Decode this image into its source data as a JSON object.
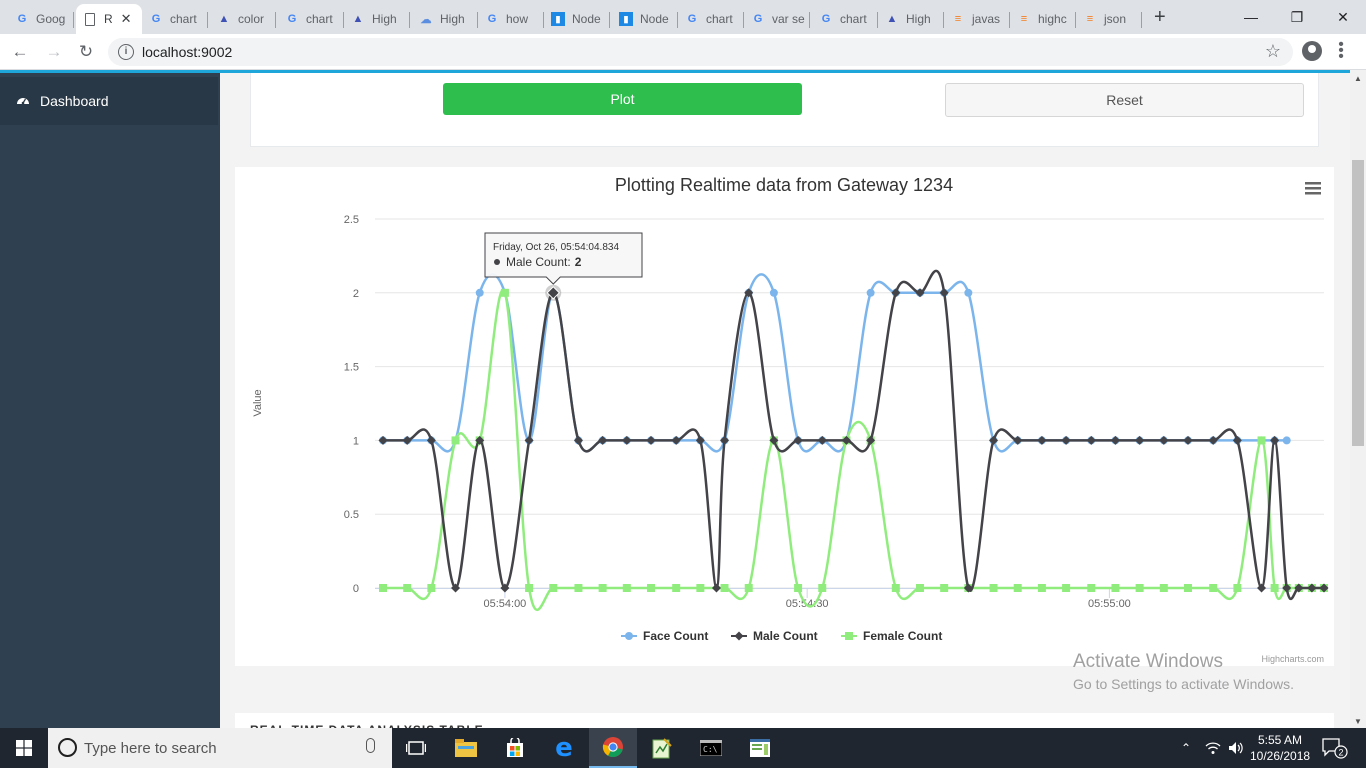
{
  "browser": {
    "tabs": [
      {
        "label": "Goog",
        "icon": "google-icon"
      },
      {
        "label": "R",
        "icon": "page-icon",
        "active": true
      },
      {
        "label": "chart",
        "icon": "google-icon"
      },
      {
        "label": "color",
        "icon": "azure-icon"
      },
      {
        "label": "chart",
        "icon": "google-icon"
      },
      {
        "label": "High",
        "icon": "azure-icon"
      },
      {
        "label": "High",
        "icon": "cloud-icon"
      },
      {
        "label": "how",
        "icon": "google-icon"
      },
      {
        "label": "Node",
        "icon": "bar-chart-icon"
      },
      {
        "label": "Node",
        "icon": "bar-chart-icon"
      },
      {
        "label": "chart",
        "icon": "google-icon"
      },
      {
        "label": "var se",
        "icon": "g-icon"
      },
      {
        "label": "chart",
        "icon": "google-icon"
      },
      {
        "label": "High",
        "icon": "azure-icon"
      },
      {
        "label": "javas",
        "icon": "stack-overflow-icon"
      },
      {
        "label": "highc",
        "icon": "stack-overflow-icon"
      },
      {
        "label": "json",
        "icon": "stack-overflow-icon"
      }
    ],
    "url": "localhost:9002"
  },
  "sidebar": {
    "items": [
      {
        "label": "Dashboard",
        "icon": "dashboard-icon"
      }
    ]
  },
  "controls": {
    "plot_label": "Plot",
    "reset_label": "Reset"
  },
  "chart_data": {
    "type": "line",
    "title": "Plotting Realtime data from Gateway 1234",
    "xlabel": "",
    "ylabel": "Value",
    "ylim": [
      0,
      2.5
    ],
    "yticks": [
      "0",
      "0.5",
      "1",
      "1.5",
      "2",
      "2.5"
    ],
    "xticks": [
      {
        "label": "05:54:00",
        "t": 10
      },
      {
        "label": "05:54:30",
        "t": 40
      },
      {
        "label": "05:55:00",
        "t": 70
      }
    ],
    "time_offset_label": "seconds",
    "grid": true,
    "legend": "bottom-center",
    "series": [
      {
        "name": "Face Count",
        "color": "#7cb5ec",
        "marker": "circle",
        "points": [
          [
            -2.1,
            1
          ],
          [
            0.3,
            1
          ],
          [
            2.7,
            1
          ],
          [
            5.1,
            1
          ],
          [
            7.5,
            2
          ],
          [
            10,
            2
          ],
          [
            12.4,
            1
          ],
          [
            14.8,
            2
          ],
          [
            17.3,
            1
          ],
          [
            19.7,
            1
          ],
          [
            22.1,
            1
          ],
          [
            24.5,
            1
          ],
          [
            27,
            1
          ],
          [
            29.4,
            1
          ],
          [
            31.8,
            1
          ],
          [
            34.2,
            2
          ],
          [
            36.7,
            2
          ],
          [
            39.1,
            1
          ],
          [
            41.5,
            1
          ],
          [
            43.9,
            1
          ],
          [
            46.3,
            2
          ],
          [
            48.8,
            2
          ],
          [
            51.2,
            2
          ],
          [
            53.6,
            2
          ],
          [
            56,
            2
          ],
          [
            58.5,
            1
          ],
          [
            60.9,
            1
          ],
          [
            63.3,
            1
          ],
          [
            65.7,
            1
          ],
          [
            68.2,
            1
          ],
          [
            70.6,
            1
          ],
          [
            73,
            1
          ],
          [
            75.4,
            1
          ],
          [
            77.8,
            1
          ],
          [
            80.3,
            1
          ],
          [
            82.7,
            1
          ],
          [
            85.1,
            1
          ],
          [
            86.4,
            1
          ],
          [
            87.6,
            1
          ]
        ]
      },
      {
        "name": "Male Count",
        "color": "#434348",
        "marker": "diamond",
        "points": [
          [
            -2.1,
            1
          ],
          [
            0.3,
            1
          ],
          [
            2.7,
            1
          ],
          [
            5.1,
            0
          ],
          [
            7.5,
            1
          ],
          [
            10,
            0
          ],
          [
            12.4,
            1
          ],
          [
            14.8,
            2
          ],
          [
            17.3,
            1
          ],
          [
            19.7,
            1
          ],
          [
            22.1,
            1
          ],
          [
            24.5,
            1
          ],
          [
            27,
            1
          ],
          [
            29.4,
            1
          ],
          [
            31,
            0
          ],
          [
            31.8,
            1
          ],
          [
            34.2,
            2
          ],
          [
            36.7,
            1
          ],
          [
            39.1,
            1
          ],
          [
            41.5,
            1
          ],
          [
            43.9,
            1
          ],
          [
            46.3,
            1
          ],
          [
            48.8,
            2
          ],
          [
            51.2,
            2
          ],
          [
            53.6,
            2
          ],
          [
            56,
            0
          ],
          [
            58.5,
            1
          ],
          [
            60.9,
            1
          ],
          [
            63.3,
            1
          ],
          [
            65.7,
            1
          ],
          [
            68.2,
            1
          ],
          [
            70.6,
            1
          ],
          [
            73,
            1
          ],
          [
            75.4,
            1
          ],
          [
            77.8,
            1
          ],
          [
            80.3,
            1
          ],
          [
            82.7,
            1
          ],
          [
            85.1,
            0
          ],
          [
            86.4,
            1
          ],
          [
            87.6,
            0
          ],
          [
            88.8,
            0
          ],
          [
            90.1,
            0
          ],
          [
            91.3,
            0
          ]
        ]
      },
      {
        "name": "Female Count",
        "color": "#90ed7d",
        "marker": "square",
        "points": [
          [
            -2.1,
            0
          ],
          [
            0.3,
            0
          ],
          [
            2.7,
            0
          ],
          [
            5.1,
            1
          ],
          [
            7.5,
            1
          ],
          [
            10,
            2
          ],
          [
            12.4,
            0
          ],
          [
            14.8,
            0
          ],
          [
            17.3,
            0
          ],
          [
            19.7,
            0
          ],
          [
            22.1,
            0
          ],
          [
            24.5,
            0
          ],
          [
            27,
            0
          ],
          [
            29.4,
            0
          ],
          [
            31.8,
            0
          ],
          [
            34.2,
            0
          ],
          [
            36.7,
            1
          ],
          [
            39.1,
            0
          ],
          [
            41.5,
            0
          ],
          [
            43.9,
            1
          ],
          [
            46.3,
            1
          ],
          [
            48.8,
            0
          ],
          [
            51.2,
            0
          ],
          [
            53.6,
            0
          ],
          [
            56,
            0
          ],
          [
            58.5,
            0
          ],
          [
            60.9,
            0
          ],
          [
            63.3,
            0
          ],
          [
            65.7,
            0
          ],
          [
            68.2,
            0
          ],
          [
            70.6,
            0
          ],
          [
            73,
            0
          ],
          [
            75.4,
            0
          ],
          [
            77.8,
            0
          ],
          [
            80.3,
            0
          ],
          [
            82.7,
            0
          ],
          [
            85.1,
            1
          ],
          [
            86.4,
            0
          ],
          [
            87.6,
            0
          ],
          [
            88.8,
            0
          ],
          [
            90.1,
            0
          ],
          [
            91.3,
            0
          ]
        ]
      }
    ],
    "tooltip": {
      "date": "Friday, Oct 26, 05:54:04.834",
      "series": "Male Count",
      "value": "2"
    },
    "credits": "Highcharts.com"
  },
  "bottom_section": {
    "title": "REAL-TIME DATA ANALYSIS TABLE"
  },
  "watermark": {
    "line1": "Activate Windows",
    "line2": "Go to Settings to activate Windows."
  },
  "taskbar": {
    "search_placeholder": "Type here to search",
    "time": "5:55 AM",
    "date": "10/26/2018",
    "notifications": "2"
  }
}
